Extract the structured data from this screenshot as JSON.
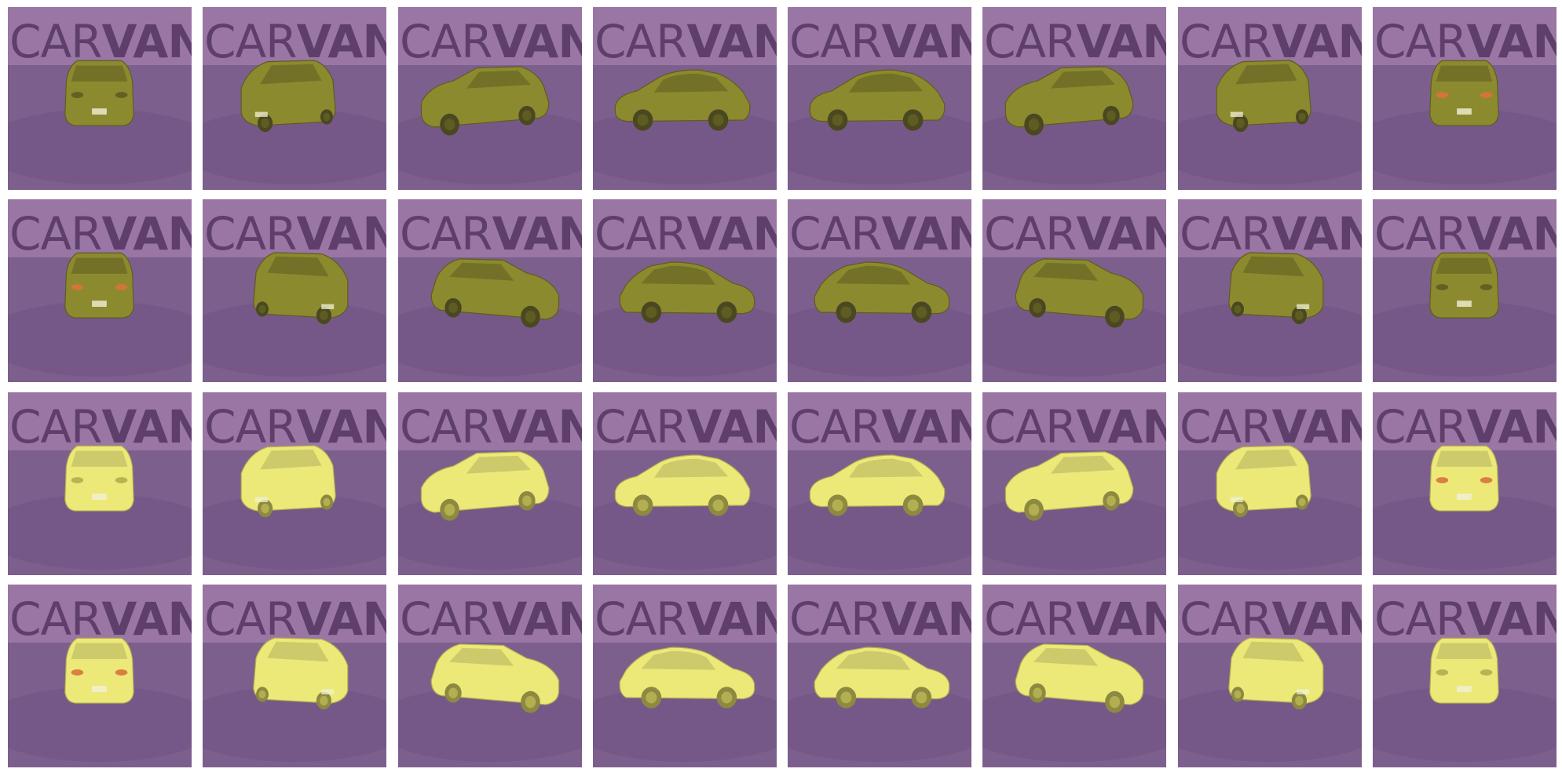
{
  "colors": {
    "backdrop": "#9a76a4",
    "floor": "#7d5f8e",
    "turntable": "#745686",
    "wordmark": "#5e3f6b",
    "mask_dark_car": "#8c8a2e",
    "mask_dark_car_shade": "#5e5c20",
    "mask_light_car": "#ece978",
    "mask_light_car_shade": "#b3ae50",
    "window_dark": "#6f6c26",
    "window_light": "#c8c46a",
    "wheel_dark": "#4a4820",
    "wheel_light": "#8c8940"
  },
  "wordmark": {
    "prefix": "CAR",
    "suffix": "VANA"
  },
  "rows": [
    {
      "car": "dark",
      "views": [
        "front",
        "front-left-3q",
        "left-front-3q",
        "left",
        "left",
        "left-rear-3q",
        "rear-left-3q",
        "rear"
      ]
    },
    {
      "car": "dark",
      "views": [
        "rear",
        "rear-right-3q",
        "right-rear-3q",
        "right",
        "right",
        "right-front-3q",
        "front-right-3q",
        "front"
      ]
    },
    {
      "car": "light",
      "views": [
        "front",
        "front-left-3q",
        "left-front-3q",
        "left",
        "left",
        "left-rear-3q",
        "rear-left-3q",
        "rear"
      ]
    },
    {
      "car": "light",
      "views": [
        "rear",
        "rear-right-3q",
        "right-rear-3q",
        "right",
        "right",
        "right-front-3q",
        "front-right-3q",
        "front"
      ]
    }
  ]
}
